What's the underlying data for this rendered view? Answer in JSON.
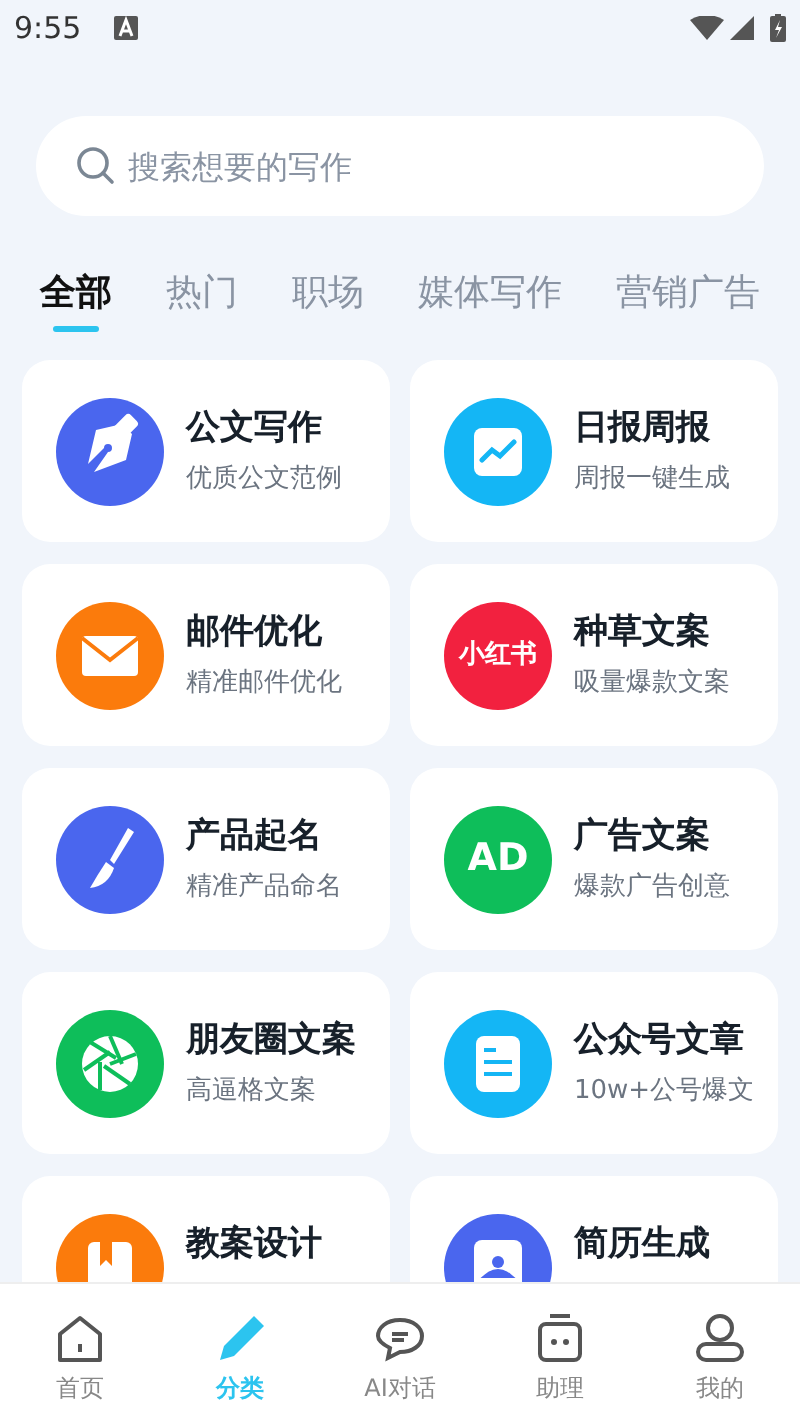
{
  "status_bar": {
    "time": "9:55"
  },
  "search": {
    "placeholder": "搜索想要的写作"
  },
  "tabs": [
    {
      "label": "全部",
      "selected": true
    },
    {
      "label": "热门",
      "selected": false
    },
    {
      "label": "职场",
      "selected": false
    },
    {
      "label": "媒体写作",
      "selected": false
    },
    {
      "label": "营销广告",
      "selected": false
    }
  ],
  "cards": [
    {
      "title": "公文写作",
      "subtitle": "优质公文范例",
      "kind": "pen",
      "color": "#4a66ee"
    },
    {
      "title": "日报周报",
      "subtitle": "周报一键生成",
      "kind": "chart",
      "color": "#14b6f5"
    },
    {
      "title": "邮件优化",
      "subtitle": "精准邮件优化",
      "kind": "mail",
      "color": "#fb7b0c"
    },
    {
      "title": "种草文案",
      "subtitle": "吸量爆款文案",
      "kind": "badge",
      "icon_text": "小红书",
      "color": "#f2213f"
    },
    {
      "title": "产品起名",
      "subtitle": "精准产品命名",
      "kind": "brush",
      "color": "#4a66ee"
    },
    {
      "title": "广告文案",
      "subtitle": "爆款广告创意",
      "kind": "badge",
      "icon_text": "AD",
      "color": "#0ebe5a"
    },
    {
      "title": "朋友圈文案",
      "subtitle": "高逼格文案",
      "kind": "aperture",
      "color": "#0ebe5a"
    },
    {
      "title": "公众号文章",
      "subtitle": "10w+公号爆文",
      "kind": "doc",
      "color": "#14b6f5"
    },
    {
      "title": "教案设计",
      "kind": "book",
      "color": "#fb7b0c"
    },
    {
      "title": "简历生成",
      "kind": "resume",
      "color": "#4a66ee"
    }
  ],
  "nav": [
    {
      "label": "首页",
      "kind": "home",
      "selected": false
    },
    {
      "label": "分类",
      "kind": "pencil",
      "selected": true
    },
    {
      "label": "AI对话",
      "kind": "chat",
      "selected": false
    },
    {
      "label": "助理",
      "kind": "robot",
      "selected": false
    },
    {
      "label": "我的",
      "kind": "user",
      "selected": false
    }
  ]
}
